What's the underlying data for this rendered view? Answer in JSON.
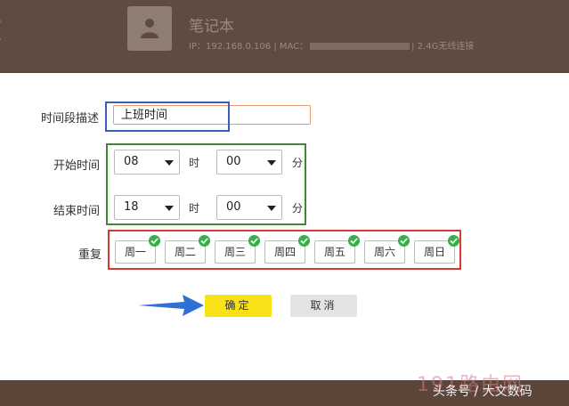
{
  "device": {
    "name": "笔记本",
    "info_prefix": "IP：192.168.0.106 | MAC：",
    "info_suffix": "| 2.4G无线连接"
  },
  "form": {
    "desc_label": "时间段描述",
    "desc_value": "上班时间",
    "start_label": "开始时间",
    "end_label": "结束时间",
    "repeat_label": "重复",
    "start_hour": "08",
    "start_minute": "00",
    "end_hour": "18",
    "end_minute": "00",
    "hour_unit": "时",
    "minute_unit": "分"
  },
  "days": [
    {
      "label": "周一",
      "checked": true
    },
    {
      "label": "周二",
      "checked": true
    },
    {
      "label": "周三",
      "checked": true
    },
    {
      "label": "周四",
      "checked": true
    },
    {
      "label": "周五",
      "checked": true
    },
    {
      "label": "周六",
      "checked": true
    },
    {
      "label": "周日",
      "checked": true
    }
  ],
  "buttons": {
    "ok": "确定",
    "cancel": "取消"
  },
  "annotation_colors": {
    "blue": "#3a5fb8",
    "green": "#3a8a2e",
    "red": "#d23b35",
    "arrow": "#2f6fd6"
  },
  "watermark": "191路由网",
  "source_tag": "头条号 / 大文数码"
}
